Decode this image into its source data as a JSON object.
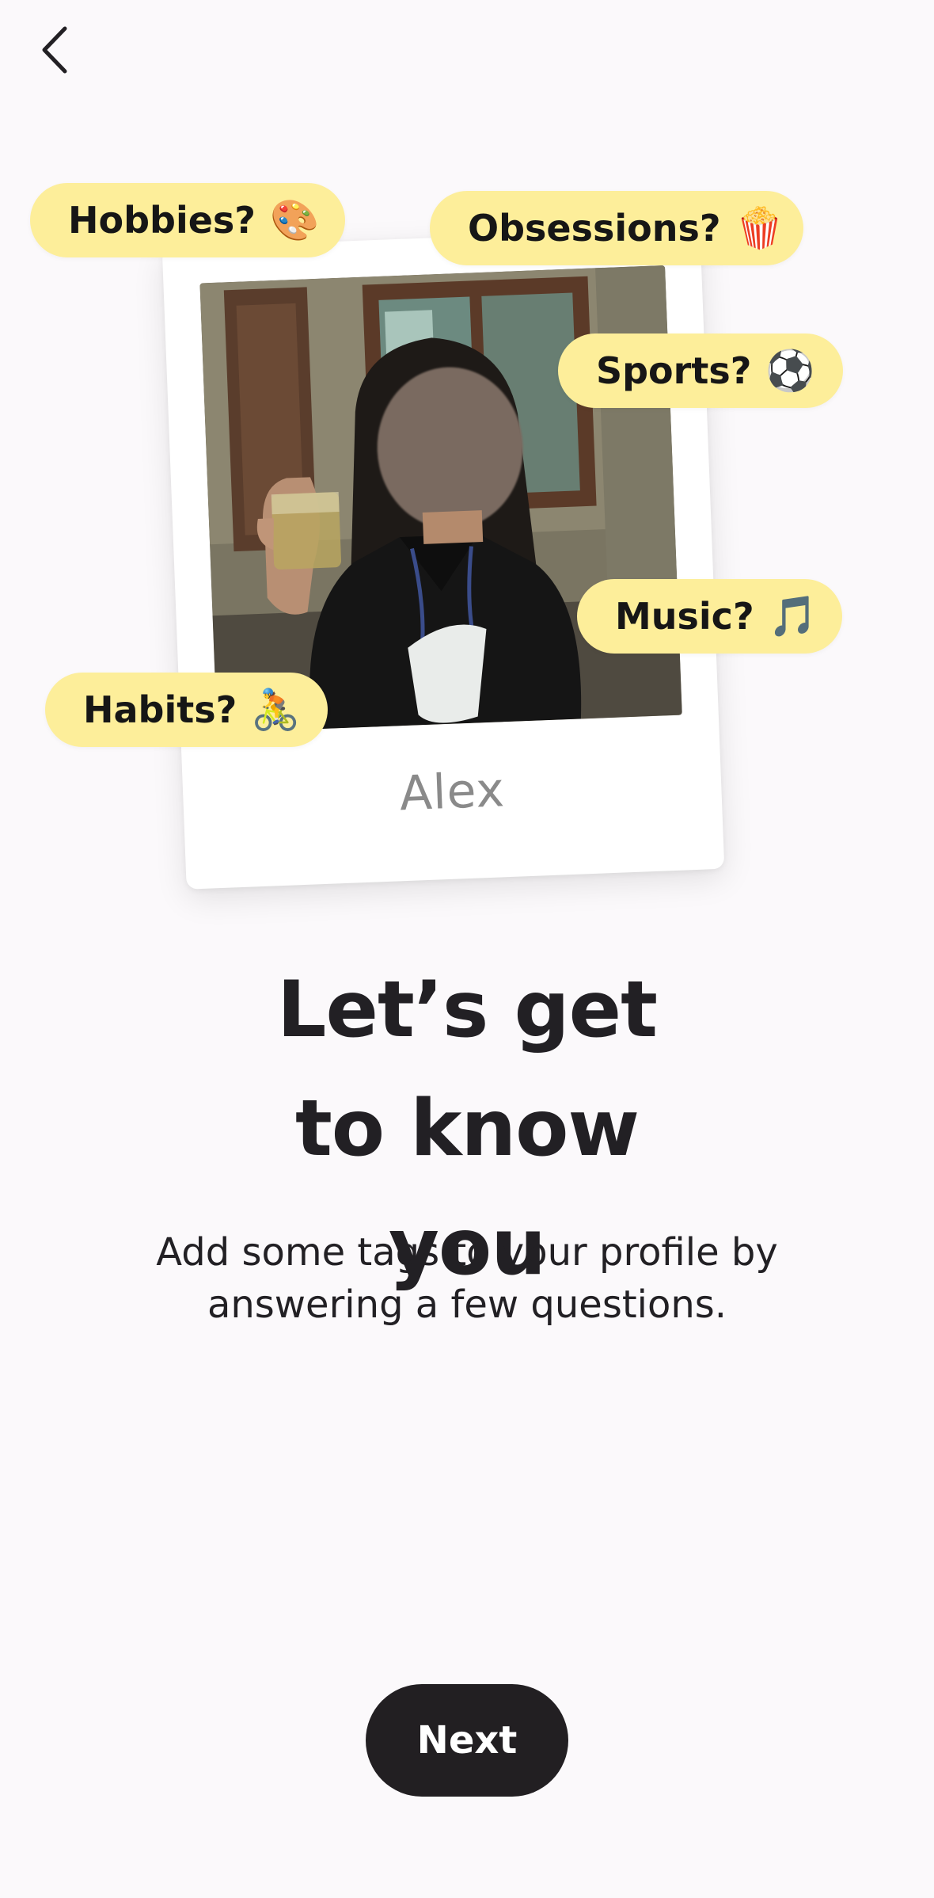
{
  "nav": {
    "back_icon": "chevron-left-icon"
  },
  "profile_card": {
    "name": "Alex"
  },
  "tags": [
    {
      "label": "Hobbies?",
      "emoji": "🎨"
    },
    {
      "label": "Obsessions?",
      "emoji": "🍿"
    },
    {
      "label": "Sports?",
      "emoji": "⚽"
    },
    {
      "label": "Music?",
      "emoji": "🎵"
    },
    {
      "label": "Habits?",
      "emoji": "🚴"
    }
  ],
  "headline": "Let’s get to know you",
  "subtitle": "Add some tags to your profile by answering a few questions.",
  "next_button": {
    "label": "Next"
  },
  "colors": {
    "background": "#fbf9fb",
    "tag_background": "#fdee9a",
    "button_background": "#221f22",
    "button_text": "#ffffff",
    "text_primary": "#222024",
    "name_text": "#8a8a8a"
  }
}
